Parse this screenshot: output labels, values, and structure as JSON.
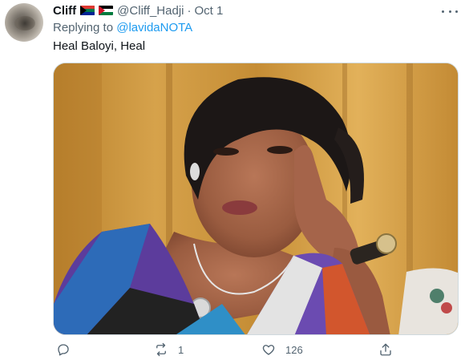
{
  "tweet": {
    "author_name": "Cliff",
    "flags": [
      "south-africa-flag",
      "palestine-flag"
    ],
    "handle": "@Cliff_Hadji",
    "separator": "·",
    "date": "Oct 1",
    "reply_prefix": "Replying to ",
    "reply_to": "@lavidaNOTA",
    "text": "Heal Baloyi, Heal"
  },
  "actions": {
    "reply_count": "",
    "retweet_count": "1",
    "like_count": "126"
  },
  "colors": {
    "link": "#1d9bf0",
    "muted": "#536471",
    "text": "#0f1419"
  }
}
